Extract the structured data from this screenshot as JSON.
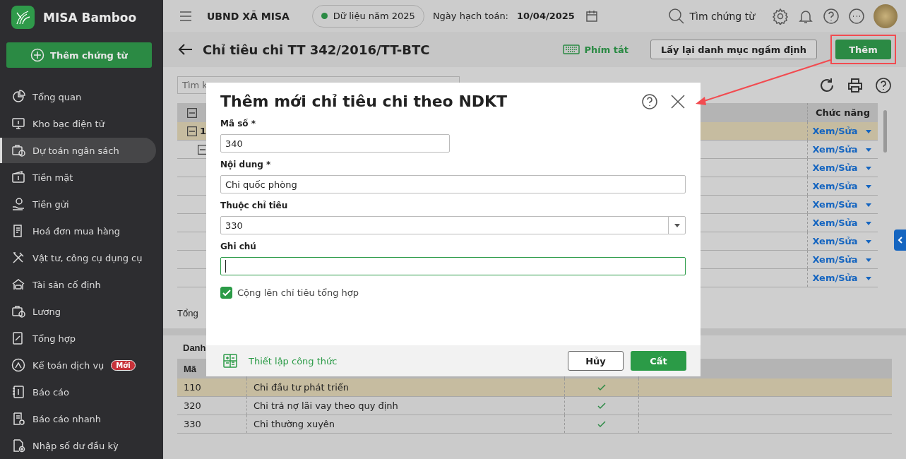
{
  "app": {
    "name": "MISA Bamboo"
  },
  "sidebar": {
    "new_button": "Thêm chứng từ",
    "items": [
      {
        "label": "Tổng quan",
        "selected": false
      },
      {
        "label": "Kho bạc điện tử",
        "selected": false
      },
      {
        "label": "Dự toán ngân sách",
        "selected": true
      },
      {
        "label": "Tiền mặt",
        "selected": false
      },
      {
        "label": "Tiền gửi",
        "selected": false
      },
      {
        "label": "Hoá đơn mua hàng",
        "selected": false
      },
      {
        "label": "Vật tư, công cụ dụng cụ",
        "selected": false
      },
      {
        "label": "Tài sản cố định",
        "selected": false
      },
      {
        "label": "Lương",
        "selected": false
      },
      {
        "label": "Tổng hợp",
        "selected": false
      },
      {
        "label": "Kế toán dịch vụ",
        "selected": false,
        "badge": "Mới"
      },
      {
        "label": "Báo cáo",
        "selected": false
      },
      {
        "label": "Báo cáo nhanh",
        "selected": false
      },
      {
        "label": "Nhập số dư đầu kỳ",
        "selected": false
      }
    ]
  },
  "topbar": {
    "org": "UBND XÃ MISA",
    "data_year": "Dữ liệu năm 2025",
    "date_label": "Ngày hạch toán:",
    "date": "10/04/2025",
    "search": "Tìm chứng từ"
  },
  "page": {
    "title": "Chỉ tiêu chi TT 342/2016/TT-BTC",
    "shortcuts": "Phím tắt",
    "buttons": [
      {
        "label": "Lấy lại danh mục ngầm định",
        "kind": "outline",
        "highlighted": false
      },
      {
        "label": "Thêm",
        "kind": "primary",
        "highlighted": true
      }
    ]
  },
  "main_table": {
    "search_placeholder": "Tìm k",
    "columns": [
      "Chức năng"
    ],
    "rows": [
      {
        "code": "1",
        "expanded": true,
        "selected": true,
        "action": "Xem/Sửa",
        "children": [
          {
            "expanded": true,
            "selected": false,
            "action": "Xem/Sửa",
            "children": [
              {
                "selected": false,
                "action": "Xem/Sửa"
              },
              {
                "selected": false,
                "action": "Xem/Sửa"
              },
              {
                "selected": false,
                "action": "Xem/Sửa"
              },
              {
                "selected": false,
                "action": "Xem/Sửa"
              },
              {
                "selected": false,
                "action": "Xem/Sửa"
              },
              {
                "selected": false,
                "action": "Xem/Sửa"
              },
              {
                "selected": false,
                "action": "Xem/Sửa"
              }
            ]
          }
        ]
      }
    ],
    "total_label": "Tổng"
  },
  "detail_panel": {
    "title": "Danh",
    "columns": [
      "Mã"
    ],
    "rows": [
      {
        "code": "110",
        "name": "Chi đầu tư phát triển",
        "checked": true,
        "selected": true
      },
      {
        "code": "320",
        "name": "Chi trả nợ lãi vay theo quy định",
        "checked": true,
        "selected": false
      },
      {
        "code": "330",
        "name": "Chi thường xuyên",
        "checked": true,
        "selected": false
      }
    ]
  },
  "dialog": {
    "title": "Thêm mới chỉ tiêu chi theo NDKT",
    "fields": [
      {
        "label": "Mã số *",
        "value": "340",
        "kind": "code",
        "focused": false
      },
      {
        "label": "Nội dung *",
        "value": "Chi quốc phòng",
        "kind": "text",
        "focused": false
      },
      {
        "label": "Thuộc chỉ tiêu",
        "value": "330",
        "kind": "select",
        "focused": false
      },
      {
        "label": "Ghi chú",
        "kind": "text",
        "focused": true
      }
    ],
    "checkbox": {
      "label": "Cộng lên chỉ tiêu tổng hợp",
      "checked": true
    },
    "formula_link": "Thiết lập công thức",
    "buttons": [
      {
        "label": "Hủy",
        "kind": "secondary"
      },
      {
        "label": "Cất",
        "kind": "primary"
      }
    ]
  }
}
